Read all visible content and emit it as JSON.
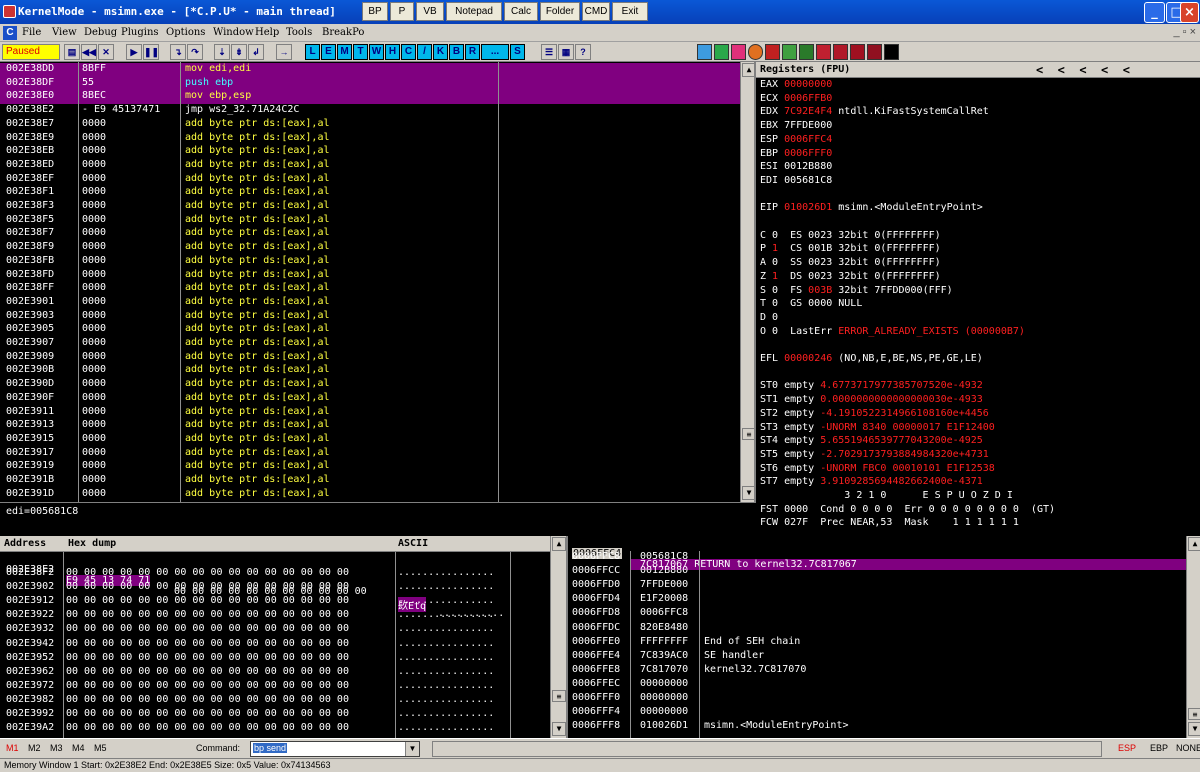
{
  "window": {
    "title": "KernelMode - msimn.exe - [*C.P.U* - main thread]",
    "quick_buttons": [
      "BP",
      "P",
      "VB",
      "Notepad",
      "Calc",
      "Folder",
      "CMD",
      "Exit"
    ]
  },
  "menu": {
    "items": [
      "File",
      "View",
      "Debug",
      "Plugins",
      "Options",
      "Window",
      "Help",
      "Tools",
      "BreakPo"
    ],
    "mdi_controls": "_ ▫ ×"
  },
  "toolbar": {
    "status": "Paused",
    "letter_buttons": [
      "L",
      "E",
      "M",
      "T",
      "W",
      "H",
      "C",
      "/",
      "K",
      "B",
      "R",
      "...",
      "S"
    ]
  },
  "cpu": {
    "rows": [
      {
        "addr": "002E38DD",
        "hex": "8BFF",
        "asm": "mov edi,edi",
        "hl": true
      },
      {
        "addr": "002E38DF",
        "hex": "55",
        "asm": "push ebp",
        "hl": true
      },
      {
        "addr": "002E38E0",
        "hex": "8BEC",
        "asm": "mov ebp,esp",
        "hl": true
      },
      {
        "addr": "002E38E2",
        "hex": "- E9 45137471",
        "asm": "jmp ws2_32.71A24C2C",
        "hl": false
      },
      {
        "addr": "002E38E7",
        "hex": "0000",
        "asm": "add byte ptr ds:[eax],al",
        "hl": false
      },
      {
        "addr": "002E38E9",
        "hex": "0000",
        "asm": "add byte ptr ds:[eax],al",
        "hl": false
      },
      {
        "addr": "002E38EB",
        "hex": "0000",
        "asm": "add byte ptr ds:[eax],al",
        "hl": false
      },
      {
        "addr": "002E38ED",
        "hex": "0000",
        "asm": "add byte ptr ds:[eax],al",
        "hl": false
      },
      {
        "addr": "002E38EF",
        "hex": "0000",
        "asm": "add byte ptr ds:[eax],al",
        "hl": false
      },
      {
        "addr": "002E38F1",
        "hex": "0000",
        "asm": "add byte ptr ds:[eax],al",
        "hl": false
      },
      {
        "addr": "002E38F3",
        "hex": "0000",
        "asm": "add byte ptr ds:[eax],al",
        "hl": false
      },
      {
        "addr": "002E38F5",
        "hex": "0000",
        "asm": "add byte ptr ds:[eax],al",
        "hl": false
      },
      {
        "addr": "002E38F7",
        "hex": "0000",
        "asm": "add byte ptr ds:[eax],al",
        "hl": false
      },
      {
        "addr": "002E38F9",
        "hex": "0000",
        "asm": "add byte ptr ds:[eax],al",
        "hl": false
      },
      {
        "addr": "002E38FB",
        "hex": "0000",
        "asm": "add byte ptr ds:[eax],al",
        "hl": false
      },
      {
        "addr": "002E38FD",
        "hex": "0000",
        "asm": "add byte ptr ds:[eax],al",
        "hl": false
      },
      {
        "addr": "002E38FF",
        "hex": "0000",
        "asm": "add byte ptr ds:[eax],al",
        "hl": false
      },
      {
        "addr": "002E3901",
        "hex": "0000",
        "asm": "add byte ptr ds:[eax],al",
        "hl": false
      },
      {
        "addr": "002E3903",
        "hex": "0000",
        "asm": "add byte ptr ds:[eax],al",
        "hl": false
      },
      {
        "addr": "002E3905",
        "hex": "0000",
        "asm": "add byte ptr ds:[eax],al",
        "hl": false
      },
      {
        "addr": "002E3907",
        "hex": "0000",
        "asm": "add byte ptr ds:[eax],al",
        "hl": false
      },
      {
        "addr": "002E3909",
        "hex": "0000",
        "asm": "add byte ptr ds:[eax],al",
        "hl": false
      },
      {
        "addr": "002E390B",
        "hex": "0000",
        "asm": "add byte ptr ds:[eax],al",
        "hl": false
      },
      {
        "addr": "002E390D",
        "hex": "0000",
        "asm": "add byte ptr ds:[eax],al",
        "hl": false
      },
      {
        "addr": "002E390F",
        "hex": "0000",
        "asm": "add byte ptr ds:[eax],al",
        "hl": false
      },
      {
        "addr": "002E3911",
        "hex": "0000",
        "asm": "add byte ptr ds:[eax],al",
        "hl": false
      },
      {
        "addr": "002E3913",
        "hex": "0000",
        "asm": "add byte ptr ds:[eax],al",
        "hl": false
      },
      {
        "addr": "002E3915",
        "hex": "0000",
        "asm": "add byte ptr ds:[eax],al",
        "hl": false
      },
      {
        "addr": "002E3917",
        "hex": "0000",
        "asm": "add byte ptr ds:[eax],al",
        "hl": false
      },
      {
        "addr": "002E3919",
        "hex": "0000",
        "asm": "add byte ptr ds:[eax],al",
        "hl": false
      },
      {
        "addr": "002E391B",
        "hex": "0000",
        "asm": "add byte ptr ds:[eax],al",
        "hl": false
      },
      {
        "addr": "002E391D",
        "hex": "0000",
        "asm": "add byte ptr ds:[eax],al",
        "hl": false
      }
    ],
    "info": "edi=005681C8"
  },
  "registers": {
    "title": "Registers (FPU)",
    "arrows": "<  <  <  <  <",
    "lines": [
      {
        "t": "EAX ",
        "v": "00000000",
        "r": "",
        "red": true
      },
      {
        "t": "ECX ",
        "v": "0006FFB0",
        "r": "",
        "red": true
      },
      {
        "t": "EDX ",
        "v": "7C92E4F4",
        "r": " ntdll.KiFastSystemCallRet",
        "red": true
      },
      {
        "t": "EBX 7FFDE000",
        "v": "",
        "r": "",
        "red": false
      },
      {
        "t": "ESP ",
        "v": "0006FFC4",
        "r": "",
        "red": true
      },
      {
        "t": "EBP ",
        "v": "0006FFF0",
        "r": "",
        "red": true
      },
      {
        "t": "ESI 0012B880",
        "v": "",
        "r": "",
        "red": false
      },
      {
        "t": "EDI 005681C8",
        "v": "",
        "r": "",
        "red": false
      },
      {
        "t": "",
        "v": "",
        "r": "",
        "red": false
      },
      {
        "t": "EIP ",
        "v": "010026D1",
        "r": " msimn.<ModuleEntryPoint>",
        "red": true
      },
      {
        "t": "",
        "v": "",
        "r": "",
        "red": false
      },
      {
        "t": "C 0  ES 0023 32bit 0(FFFFFFFF)",
        "v": "",
        "r": "",
        "red": false
      },
      {
        "t": "P ",
        "v": "1",
        "r": "  CS 001B 32bit 0(FFFFFFFF)",
        "red": true
      },
      {
        "t": "A 0  SS 0023 32bit 0(FFFFFFFF)",
        "v": "",
        "r": "",
        "red": false
      },
      {
        "t": "Z ",
        "v": "1",
        "r": "  DS 0023 32bit 0(FFFFFFFF)",
        "red": true
      },
      {
        "t": "S 0  FS ",
        "v": "003B",
        "r": " 32bit 7FFDD000(FFF)",
        "red": true
      },
      {
        "t": "T 0  GS 0000 NULL",
        "v": "",
        "r": "",
        "red": false
      },
      {
        "t": "D 0",
        "v": "",
        "r": "",
        "red": false
      },
      {
        "t": "O 0  LastErr ",
        "v": "ERROR_ALREADY_EXISTS (000000B7)",
        "r": "",
        "red": true
      },
      {
        "t": "",
        "v": "",
        "r": "",
        "red": false
      },
      {
        "t": "EFL ",
        "v": "00000246",
        "r": " (NO,NB,E,BE,NS,PE,GE,LE)",
        "red": true
      },
      {
        "t": "",
        "v": "",
        "r": "",
        "red": false
      },
      {
        "t": "ST0 empty ",
        "v": "4.6773717977385707520e-4932",
        "r": "",
        "red": true
      },
      {
        "t": "ST1 empty ",
        "v": "0.0000000000000000030e-4933",
        "r": "",
        "red": true
      },
      {
        "t": "ST2 empty ",
        "v": "-4.1910522314966108160e+4456",
        "r": "",
        "red": true
      },
      {
        "t": "ST3 empty ",
        "v": "-UNORM 8340 00000017 E1F12400",
        "r": "",
        "red": true
      },
      {
        "t": "ST4 empty ",
        "v": "5.6551946539777043200e-4925",
        "r": "",
        "red": true
      },
      {
        "t": "ST5 empty ",
        "v": "-2.7029173793884984320e+4731",
        "r": "",
        "red": true
      },
      {
        "t": "ST6 empty ",
        "v": "-UNORM FBC0 00010101 E1F12538",
        "r": "",
        "red": true
      },
      {
        "t": "ST7 empty ",
        "v": "3.9109285694482662400e-4371",
        "r": "",
        "red": true
      },
      {
        "t": "              3 2 1 0      E S P U O Z D I",
        "v": "",
        "r": "",
        "red": false
      },
      {
        "t": "FST 0000  Cond 0 0 0 0  Err 0 0 0 0 0 0 0 0  (GT)",
        "v": "",
        "r": "",
        "red": false
      },
      {
        "t": "FCW 027F  Prec NEAR,53  Mask    1 1 1 1 1 1",
        "v": "",
        "r": "",
        "red": false
      }
    ]
  },
  "dump": {
    "headers": [
      "Address",
      "Hex dump",
      "ASCII"
    ],
    "first_row": {
      "addr": "002E38E2",
      "hl_hex": "E9 45 13 74 71",
      "rest_hex": " 00 00 00 00 00 00 00 00 00 00 00",
      "hl_ascii": "镹Etq",
      "rest_ascii": "..........."
    },
    "rows": [
      {
        "addr": "002E38F2",
        "hex": "00 00 00 00 00 00 00 00 00 00 00 00 00 00 00 00",
        "ascii": "................"
      },
      {
        "addr": "002E3902",
        "hex": "00 00 00 00 00 00 00 00 00 00 00 00 00 00 00 00",
        "ascii": "................"
      },
      {
        "addr": "002E3912",
        "hex": "00 00 00 00 00 00 00 00 00 00 00 00 00 00 00 00",
        "ascii": "................"
      },
      {
        "addr": "002E3922",
        "hex": "00 00 00 00 00 00 00 00 00 00 00 00 00 00 00 00",
        "ascii": "................"
      },
      {
        "addr": "002E3932",
        "hex": "00 00 00 00 00 00 00 00 00 00 00 00 00 00 00 00",
        "ascii": "................"
      },
      {
        "addr": "002E3942",
        "hex": "00 00 00 00 00 00 00 00 00 00 00 00 00 00 00 00",
        "ascii": "................"
      },
      {
        "addr": "002E3952",
        "hex": "00 00 00 00 00 00 00 00 00 00 00 00 00 00 00 00",
        "ascii": "................"
      },
      {
        "addr": "002E3962",
        "hex": "00 00 00 00 00 00 00 00 00 00 00 00 00 00 00 00",
        "ascii": "................"
      },
      {
        "addr": "002E3972",
        "hex": "00 00 00 00 00 00 00 00 00 00 00 00 00 00 00 00",
        "ascii": "................"
      },
      {
        "addr": "002E3982",
        "hex": "00 00 00 00 00 00 00 00 00 00 00 00 00 00 00 00",
        "ascii": "................"
      },
      {
        "addr": "002E3992",
        "hex": "00 00 00 00 00 00 00 00 00 00 00 00 00 00 00 00",
        "ascii": "................"
      },
      {
        "addr": "002E39A2",
        "hex": "00 00 00 00 00 00 00 00 00 00 00 00 00 00 00 00",
        "ascii": "................"
      }
    ]
  },
  "stack": {
    "first_row": {
      "addr": "0006FFC4",
      "val": "7C817067",
      "cmt": "RETURN to kernel32.7C817067"
    },
    "rows": [
      {
        "addr": "0006FFC8",
        "val": "005681C8",
        "cmt": ""
      },
      {
        "addr": "0006FFCC",
        "val": "0012B880",
        "cmt": ""
      },
      {
        "addr": "0006FFD0",
        "val": "7FFDE000",
        "cmt": ""
      },
      {
        "addr": "0006FFD4",
        "val": "E1F20008",
        "cmt": ""
      },
      {
        "addr": "0006FFD8",
        "val": "0006FFC8",
        "cmt": ""
      },
      {
        "addr": "0006FFDC",
        "val": "820E8480",
        "cmt": ""
      },
      {
        "addr": "0006FFE0",
        "val": "FFFFFFFF",
        "cmt": "End of SEH chain"
      },
      {
        "addr": "0006FFE4",
        "val": "7C839AC0",
        "cmt": "SE handler"
      },
      {
        "addr": "0006FFE8",
        "val": "7C817070",
        "cmt": "kernel32.7C817070"
      },
      {
        "addr": "0006FFEC",
        "val": "00000000",
        "cmt": ""
      },
      {
        "addr": "0006FFF0",
        "val": "00000000",
        "cmt": ""
      },
      {
        "addr": "0006FFF4",
        "val": "00000000",
        "cmt": ""
      },
      {
        "addr": "0006FFF8",
        "val": "010026D1",
        "cmt": "msimn.<ModuleEntryPoint>"
      }
    ]
  },
  "command": {
    "marks": [
      "M1",
      "M2",
      "M3",
      "M4",
      "M5"
    ],
    "label": "Command:",
    "value": "bp send",
    "regs": [
      "ESP",
      "EBP",
      "NONE"
    ]
  },
  "statusbar": {
    "text": "Memory Window 1  Start: 0x2E38E2  End: 0x2E38E5  Size: 0x5  Value: 0x74134563"
  }
}
